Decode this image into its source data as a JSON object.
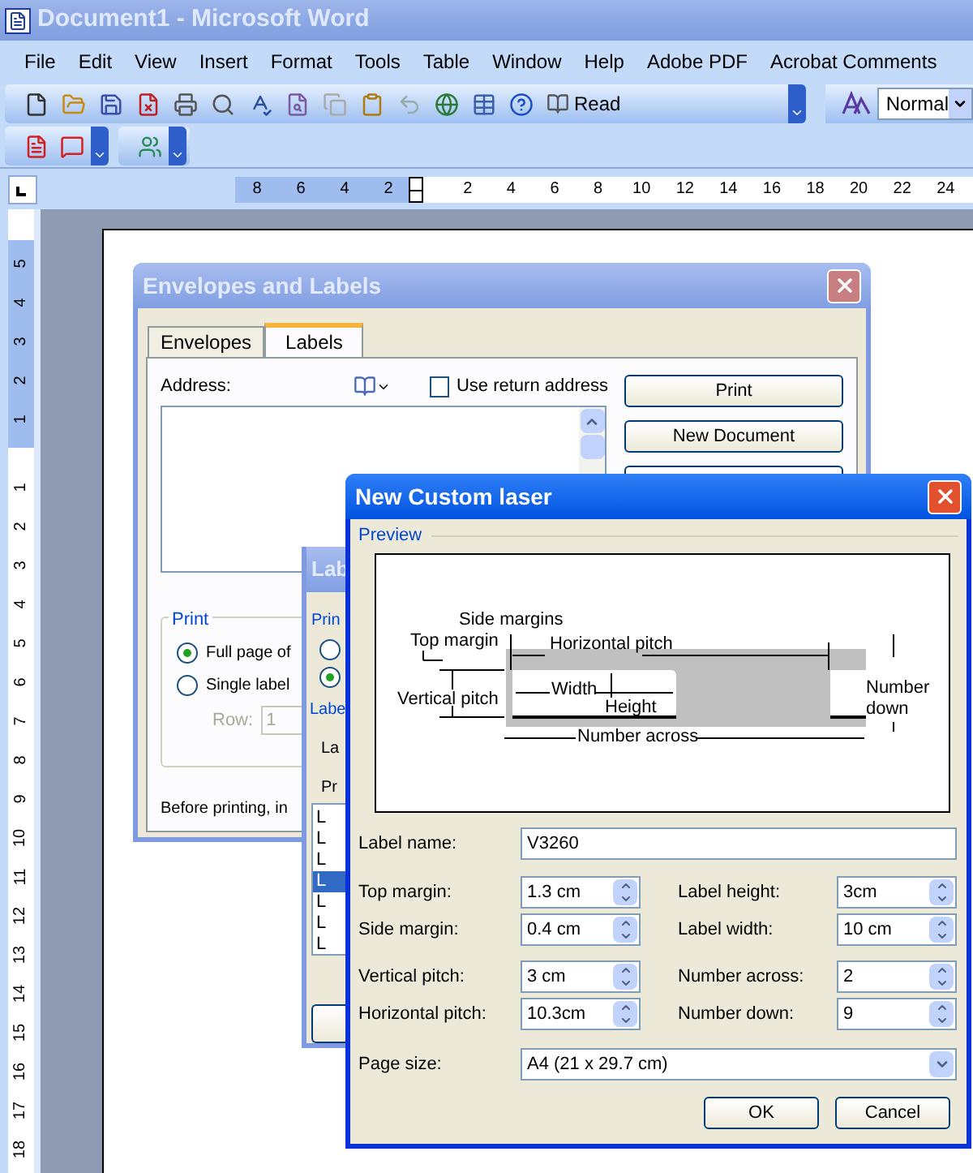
{
  "window": {
    "title": "Document1 - Microsoft Word"
  },
  "menu": [
    "File",
    "Edit",
    "View",
    "Insert",
    "Format",
    "Tools",
    "Table",
    "Window",
    "Help",
    "Adobe PDF",
    "Acrobat Comments"
  ],
  "toolbar": {
    "read_button": "Read",
    "style_box": "Normal"
  },
  "ruler": {
    "left_ticks": [
      "8",
      "6",
      "4",
      "2"
    ],
    "right_ticks": [
      "2",
      "4",
      "6",
      "8",
      "10",
      "12",
      "14",
      "16",
      "18",
      "20",
      "22",
      "24"
    ]
  },
  "vertical_ruler": {
    "top_ticks": [
      "5",
      "4",
      "3",
      "2",
      "1"
    ],
    "ticks": [
      "1",
      "2",
      "3",
      "4",
      "5",
      "6",
      "7",
      "8",
      "9",
      "10",
      "11",
      "12",
      "13",
      "14",
      "15",
      "16",
      "17",
      "18"
    ]
  },
  "envelopes_dialog": {
    "title": "Envelopes and Labels",
    "tabs": [
      {
        "label": "Envelopes",
        "selected": false
      },
      {
        "label": "Labels",
        "selected": true
      }
    ],
    "address_label": "Address:",
    "return_address": {
      "label": "Use return address",
      "checked": false
    },
    "buttons": [
      "Print",
      "New Document"
    ],
    "print_group": {
      "title": "Print",
      "options": [
        {
          "label": "Full page of",
          "selected": true
        },
        {
          "label": "Single label",
          "selected": false
        }
      ],
      "row_label": "Row:",
      "row_value": "1"
    },
    "note": "Before printing, in"
  },
  "label_options_dialog": {
    "title": "Lab",
    "print_group": "Prin",
    "radios": [
      {
        "selected": false
      },
      {
        "selected": true
      }
    ],
    "section": "Labe",
    "text_1": "La",
    "text_2": "Pr",
    "list": [
      {
        "text": "L",
        "selected": false
      },
      {
        "text": "L",
        "selected": false
      },
      {
        "text": "L",
        "selected": false
      },
      {
        "text": "L",
        "selected": true
      },
      {
        "text": "L",
        "selected": false
      },
      {
        "text": "L",
        "selected": false
      },
      {
        "text": "L",
        "selected": false
      }
    ]
  },
  "custom_dialog": {
    "title": "New Custom laser",
    "preview": {
      "title": "Preview",
      "labels": [
        "Side margins",
        "Top margin",
        "Horizontal pitch",
        "Vertical pitch",
        "Width",
        "Height",
        "Number down",
        "Number across"
      ]
    },
    "label_name": {
      "label": "Label name:",
      "value": "V3260"
    },
    "rows": [
      {
        "left": {
          "label": "Top margin:",
          "value": "1.3 cm"
        },
        "right": {
          "label": "Label height:",
          "value": "3cm"
        }
      },
      {
        "left": {
          "label": "Side margin:",
          "value": "0.4 cm"
        },
        "right": {
          "label": "Label width:",
          "value": "10 cm"
        }
      },
      {
        "left": {
          "label": "Vertical pitch:",
          "value": "3 cm"
        },
        "right": {
          "label": "Number across:",
          "value": "2"
        }
      },
      {
        "left": {
          "label": "Horizontal pitch:",
          "value": "10.3cm"
        },
        "right": {
          "label": "Number down:",
          "value": "9"
        }
      }
    ],
    "page_size": {
      "label": "Page size:",
      "value": "A4 (21 x 29.7 cm)"
    },
    "buttons": [
      "OK",
      "Cancel"
    ]
  }
}
